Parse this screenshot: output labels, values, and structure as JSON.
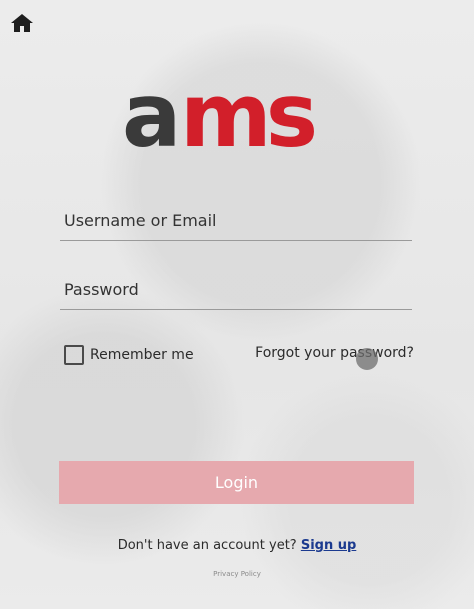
{
  "header": {
    "home_icon": "home-icon"
  },
  "brand": {
    "logo_text_a": "a",
    "logo_text_ms": "ms",
    "color_a": "#3a3a3a",
    "color_ms": "#d21f2a"
  },
  "form": {
    "username_placeholder": "Username or Email",
    "password_placeholder": "Password",
    "remember_label": "Remember me",
    "remember_checked": false,
    "forgot_label": "Forgot your password?",
    "login_label": "Login",
    "login_color": "#e6a9ae"
  },
  "footer": {
    "no_account_text": "Don't have an account yet?",
    "signup_label": "Sign up",
    "privacy_label": "Privacy Policy"
  }
}
